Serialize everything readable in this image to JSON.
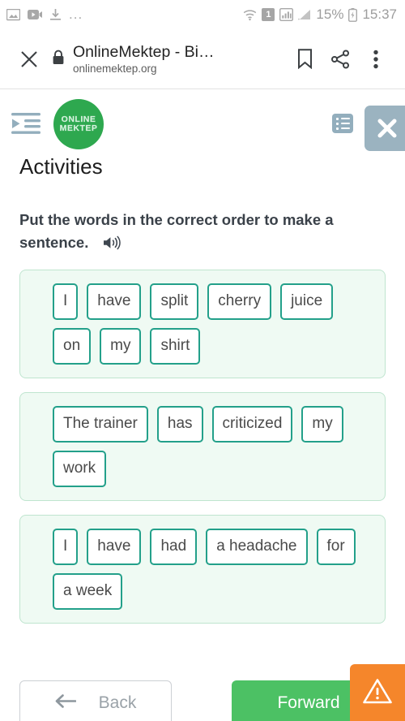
{
  "statusbar": {
    "left_icons": [
      "image-icon",
      "video-icon",
      "download-icon"
    ],
    "overflow": "...",
    "right_icons": [
      "wifi-icon",
      "sim-icon",
      "signal-bars-icon",
      "signal-triangle-icon",
      "battery-icon"
    ],
    "sim_label": "1",
    "battery_percent": "15%",
    "clock": "15:37"
  },
  "toolbar": {
    "close_icon": "close-icon",
    "lock_icon": "lock-icon",
    "title": "OnlineMektep - Bi…",
    "url": "onlinemektep.org",
    "bookmark_icon": "bookmark-icon",
    "share_icon": "share-icon",
    "menu_icon": "overflow-menu-icon"
  },
  "page": {
    "indent_icon": "indent-icon",
    "logo_line1": "ONLINE",
    "logo_line2": "MEKTEP",
    "list_icon": "list-icon",
    "close_icon": "close-icon",
    "title": "Activities",
    "prompt": "Put the words in the correct order to make a sentence.",
    "speaker_icon": "speaker-icon",
    "cards": [
      {
        "words": [
          "I",
          "have",
          "split",
          "cherry",
          "juice",
          "on",
          "my",
          "shirt"
        ]
      },
      {
        "words": [
          "The trainer",
          "has",
          "criticized",
          "my",
          "work"
        ]
      },
      {
        "words": [
          "I",
          "have",
          "had",
          "a headache",
          "for",
          "a week"
        ]
      }
    ]
  },
  "bottom": {
    "back_label": "Back",
    "back_icon": "arrow-left-icon",
    "forward_label": "Forward",
    "warning_icon": "warning-triangle-icon"
  },
  "colors": {
    "brand_green": "#2EA84F",
    "chip_border": "#23a08a",
    "card_bg": "#effaf3",
    "forward_green": "#4cc164",
    "warn_orange": "#f5862b",
    "steel_blue": "#9bb3c0"
  }
}
